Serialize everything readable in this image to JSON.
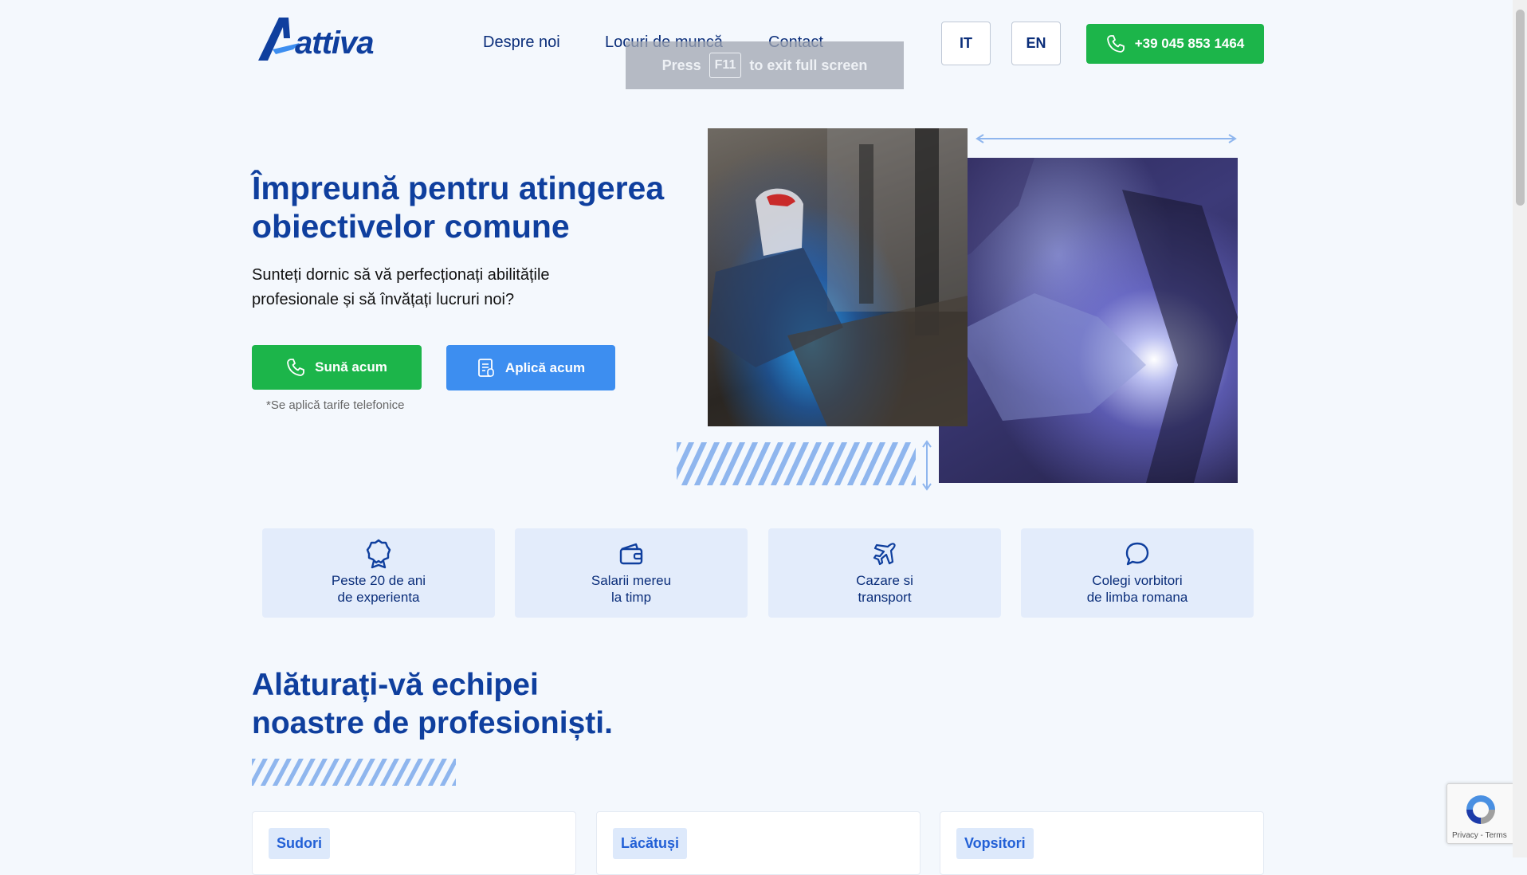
{
  "header": {
    "logo_text": "attiva",
    "nav": [
      "Despre noi",
      "Locuri de muncă",
      "Contact"
    ],
    "languages": [
      "IT",
      "EN"
    ],
    "phone": "+39 045 853 1464"
  },
  "fullscreen_notice": {
    "press": "Press",
    "key": "F11",
    "rest": "to exit full screen"
  },
  "hero": {
    "title": "Împreună pentru atingerea obiectivelor comune",
    "subtitle": "Sunteți dornic să vă perfecționați abilitățile profesionale și să învățați lucruri noi?",
    "call_button": "Sună acum",
    "apply_button": "Aplică acum",
    "note": "*Se aplică tarife telefonice"
  },
  "features": [
    {
      "icon": "award-icon",
      "line1": "Peste 20 de ani",
      "line2": "de experienta"
    },
    {
      "icon": "wallet-icon",
      "line1": "Salarii mereu",
      "line2": "la timp"
    },
    {
      "icon": "plane-icon",
      "line1": "Cazare si",
      "line2": "transport"
    },
    {
      "icon": "chat-bubble-icon",
      "line1": "Colegi vorbitori",
      "line2": "de limba romana"
    }
  ],
  "section": {
    "title_line1": "Alăturați-vă echipei",
    "title_line2": "noastre de profesioniști."
  },
  "job_cards": [
    "Sudori",
    "Lăcătuși",
    "Vopsitori"
  ],
  "recaptcha": {
    "text": "Privacy - Terms"
  },
  "colors": {
    "primary_blue": "#0f3f9e",
    "green": "#1cb54a",
    "accent_blue": "#3d8ef0",
    "feature_bg": "#e3ecfb",
    "page_bg": "#f4f8fd"
  }
}
